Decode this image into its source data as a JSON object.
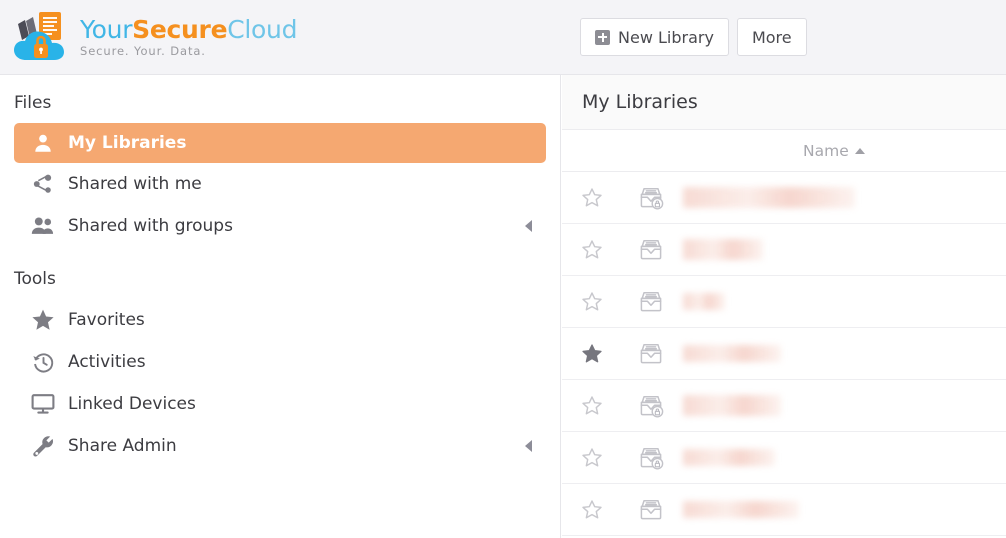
{
  "app": {
    "brand": {
      "word_part1": "Your",
      "word_part2": "Secure",
      "word_part3": "Cloud",
      "tagline": "Secure. Your. Data.",
      "colors": {
        "your": "#41b6e6",
        "secure": "#f5901f",
        "cloud": "#6fc5e8",
        "cloud_shape": "#29b3e8",
        "lock": "#f5901f",
        "doc": "#f5901f"
      }
    }
  },
  "header": {
    "buttons": [
      {
        "label": "New Library",
        "icon": "plus-square-icon"
      },
      {
        "label": "More",
        "icon": ""
      }
    ]
  },
  "sidebar": {
    "sections": [
      {
        "title": "Files",
        "items": [
          {
            "label": "My Libraries",
            "icon": "user-icon",
            "active": true,
            "caret": false
          },
          {
            "label": "Shared with me",
            "icon": "share-nodes-icon",
            "active": false,
            "caret": false
          },
          {
            "label": "Shared with groups",
            "icon": "users-group-icon",
            "active": false,
            "caret": true
          }
        ]
      },
      {
        "title": "Tools",
        "items": [
          {
            "label": "Favorites",
            "icon": "star-filled-icon",
            "active": false,
            "caret": false
          },
          {
            "label": "Activities",
            "icon": "history-clock-icon",
            "active": false,
            "caret": false
          },
          {
            "label": "Linked Devices",
            "icon": "monitor-icon",
            "active": false,
            "caret": false
          },
          {
            "label": "Share Admin",
            "icon": "wrench-icon",
            "active": false,
            "caret": true
          }
        ]
      }
    ],
    "active_accent": "#f5a871"
  },
  "main": {
    "title": "My Libraries",
    "table": {
      "columns": [
        {
          "key": "favorite",
          "label": "",
          "icon": "star-column"
        },
        {
          "key": "type",
          "label": "",
          "icon": "library-column"
        },
        {
          "key": "name",
          "label": "Name",
          "sorted": true,
          "sort_dir": "asc",
          "sort_icon": "caret-up-icon"
        }
      ],
      "rows": [
        {
          "favorite": false,
          "icon": "library-encrypted-icon",
          "name": "",
          "name_redacted": true,
          "blur_width": 172,
          "blur_tall": true
        },
        {
          "favorite": false,
          "icon": "library-icon",
          "name": "",
          "name_redacted": true,
          "blur_width": 80,
          "blur_tall": true
        },
        {
          "favorite": false,
          "icon": "library-icon",
          "name": "",
          "name_redacted": true,
          "blur_width": 42,
          "blur_tall": false
        },
        {
          "favorite": true,
          "icon": "library-icon",
          "name": "",
          "name_redacted": true,
          "blur_width": 98,
          "blur_tall": false
        },
        {
          "favorite": false,
          "icon": "library-encrypted-icon",
          "name": "",
          "name_redacted": true,
          "blur_width": 98,
          "blur_tall": true
        },
        {
          "favorite": false,
          "icon": "library-encrypted-icon",
          "name": "",
          "name_redacted": true,
          "blur_width": 92,
          "blur_tall": false
        },
        {
          "favorite": false,
          "icon": "library-icon",
          "name": "",
          "name_redacted": true,
          "blur_width": 116,
          "blur_tall": false
        }
      ]
    }
  }
}
